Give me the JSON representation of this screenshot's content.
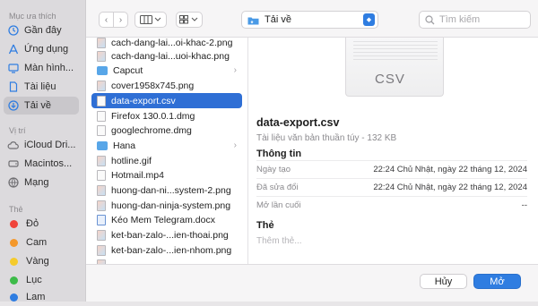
{
  "sidebar": {
    "favorites_title": "Mục ưa thích",
    "favorites": [
      {
        "label": "Gần đây",
        "icon": "clock-icon"
      },
      {
        "label": "Ứng dụng",
        "icon": "apps-icon"
      },
      {
        "label": "Màn hình...",
        "icon": "desktop-icon"
      },
      {
        "label": "Tài liệu",
        "icon": "document-icon"
      },
      {
        "label": "Tải về",
        "icon": "download-icon"
      }
    ],
    "locations_title": "Vị trí",
    "locations": [
      {
        "label": "iCloud Dri...",
        "icon": "cloud-icon"
      },
      {
        "label": "Macintos...",
        "icon": "disk-icon"
      },
      {
        "label": "Mạng",
        "icon": "network-icon"
      }
    ],
    "tags_title": "Thẻ",
    "tags": [
      {
        "label": "Đỏ",
        "color": "#f0443b"
      },
      {
        "label": "Cam",
        "color": "#f4982b"
      },
      {
        "label": "Vàng",
        "color": "#f5cb2c"
      },
      {
        "label": "Lục",
        "color": "#3dbb49"
      },
      {
        "label": "Lam",
        "color": "#2f7de1"
      }
    ]
  },
  "toolbar": {
    "back_icon": "‹",
    "forward_icon": "›",
    "location": "Tải về",
    "search_placeholder": "Tìm kiếm"
  },
  "files": [
    {
      "name": "cach-dang-lai...oi-khac-2.png",
      "type": "image"
    },
    {
      "name": "cach-dang-lai...uoi-khac.png",
      "type": "image"
    },
    {
      "name": "Capcut",
      "type": "folder"
    },
    {
      "name": "cover1958x745.png",
      "type": "image"
    },
    {
      "name": "data-export.csv",
      "type": "file"
    },
    {
      "name": "Firefox 130.0.1.dmg",
      "type": "file"
    },
    {
      "name": "googlechrome.dmg",
      "type": "file"
    },
    {
      "name": "Hana",
      "type": "folder"
    },
    {
      "name": "hotline.gif",
      "type": "image"
    },
    {
      "name": "Hotmail.mp4",
      "type": "video"
    },
    {
      "name": "huong-dan-ni...system-2.png",
      "type": "image"
    },
    {
      "name": "huong-dan-ninja-system.png",
      "type": "image"
    },
    {
      "name": "Kéo Mem Telegram.docx",
      "type": "doc"
    },
    {
      "name": "ket-ban-zalo-...ien-thoai.png",
      "type": "image"
    },
    {
      "name": "ket-ban-zalo-...ien-nhom.png",
      "type": "image"
    },
    {
      "name": "",
      "type": "image"
    }
  ],
  "selected_index": 4,
  "preview": {
    "thumb_label": "CSV",
    "name": "data-export.csv",
    "kind": "Tài liệu văn bản thuần túy - 132 KB",
    "info_title": "Thông tin",
    "meta": [
      {
        "key": "Ngày tạo",
        "value": "22:24 Chủ Nhật, ngày 22 tháng 12, 2024"
      },
      {
        "key": "Đã sửa đổi",
        "value": "22:24 Chủ Nhật, ngày 22 tháng 12, 2024"
      },
      {
        "key": "Mở lần cuối",
        "value": "--"
      }
    ],
    "tags_title": "Thẻ",
    "tags_placeholder": "Thêm thẻ..."
  },
  "buttons": {
    "cancel": "Hủy",
    "open": "Mở"
  }
}
